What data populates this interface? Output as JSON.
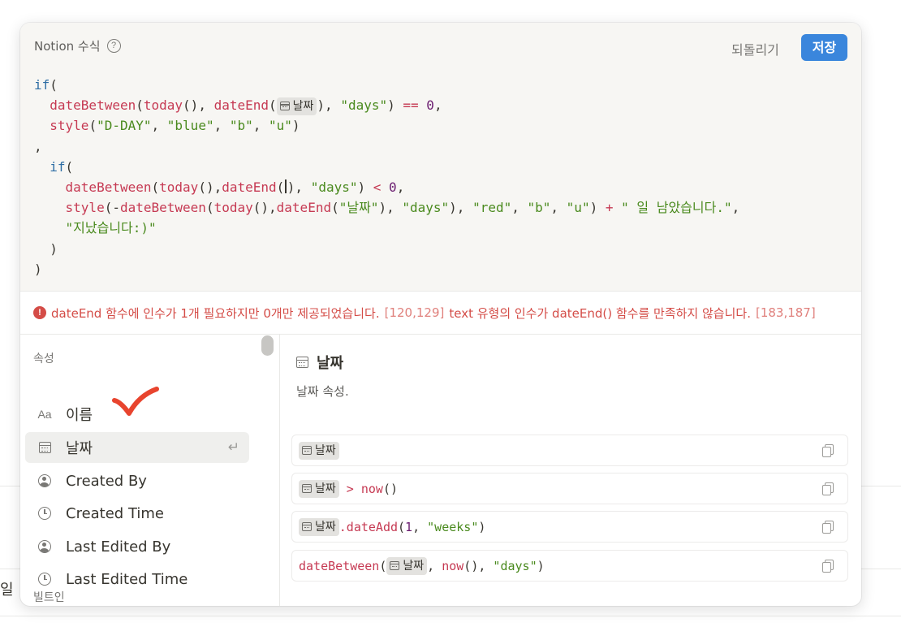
{
  "background": {
    "edge_text": "일"
  },
  "modal": {
    "title": "Notion 수식",
    "help_icon": "?",
    "revert_label": "되돌리기",
    "save_label": "저장"
  },
  "formula": {
    "date_property": "날짜",
    "lines": [
      "if(",
      "  dateBetween(today(), dateEnd([날짜]), \"days\") == 0,",
      "  style(\"D-DAY\", \"blue\", \"b\", \"u\")",
      ",",
      "  if(",
      "    dateBetween(today(),dateEnd(|), \"days\") < 0,",
      "    style(-dateBetween(today(),dateEnd(\"날짜\"), \"days\"), \"red\", \"b\", \"u\") + \" 일 남았습니다.\",",
      "    \"지났습니다:)\"",
      "  )",
      ")"
    ]
  },
  "errors": {
    "icon": "!",
    "message1": "dateEnd 함수에 인수가 1개 필요하지만 0개만 제공되었습니다.",
    "range1": "[120,129]",
    "message2": "text 유형의 인수가 dateEnd() 함수를 만족하지 않습니다.",
    "range2": "[183,187]"
  },
  "properties": {
    "section_label": "속성",
    "items": [
      {
        "label": "이름",
        "icon": "text-icon",
        "icon_text": "Aa"
      },
      {
        "label": "날짜",
        "icon": "calendar-icon",
        "selected": true
      },
      {
        "label": "Created By",
        "icon": "user-icon"
      },
      {
        "label": "Created Time",
        "icon": "clock-icon"
      },
      {
        "label": "Last Edited By",
        "icon": "user-icon"
      },
      {
        "label": "Last Edited Time",
        "icon": "clock-icon"
      }
    ],
    "builtin_label": "빌트인",
    "enter_icon": "↵"
  },
  "detail": {
    "title": "날짜",
    "description": "날짜 속성.",
    "examples": [
      {
        "chip": "날짜",
        "rest": ""
      },
      {
        "chip": "날짜",
        "op": " > ",
        "fn": "now",
        "tail": "()"
      },
      {
        "chip": "날짜",
        "fn": ".dateAdd",
        "tail1": "(",
        "num": "1",
        "tail2": ", ",
        "str": "\"weeks\"",
        "tail3": ")"
      },
      {
        "fn": "dateBetween",
        "tail1": "(",
        "chip": "날짜",
        "tail2": ", ",
        "fn2": "now",
        "tail3": "(), ",
        "str": "\"days\"",
        "tail4": ")"
      }
    ]
  },
  "colors": {
    "accent": "#3a86dc",
    "error": "#d44c47",
    "annotation": "#e8442e"
  }
}
